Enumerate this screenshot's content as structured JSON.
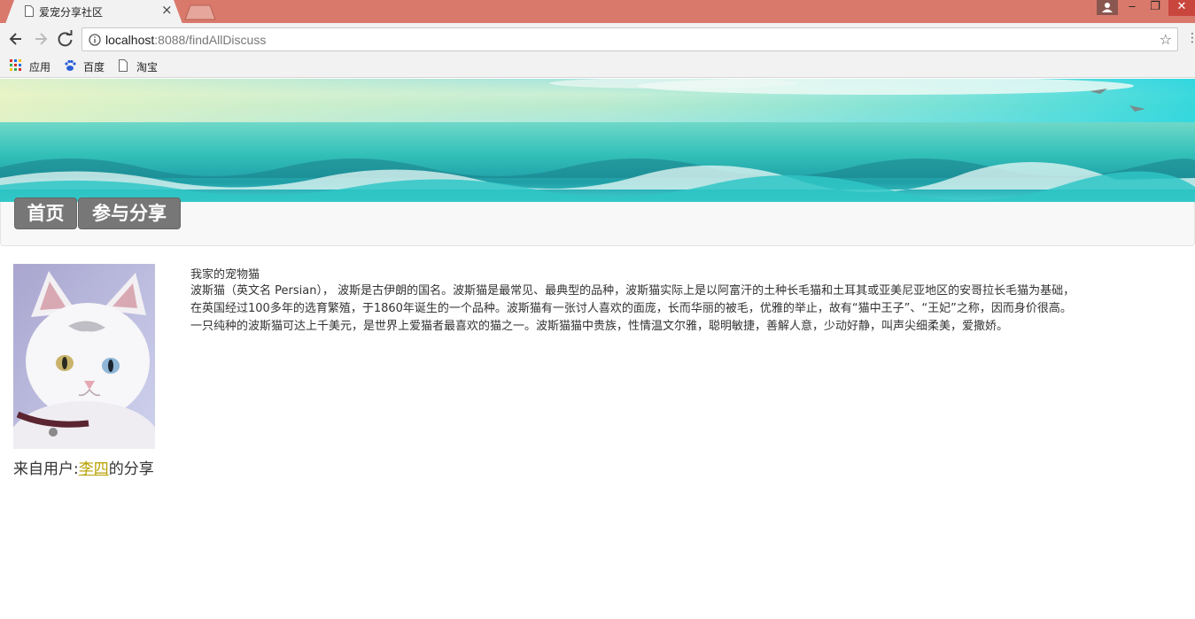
{
  "browser": {
    "tab_title": "爱宠分享社区",
    "tab_close": "×",
    "url_host": "localhost",
    "url_rest": ":8088/findAllDiscuss",
    "star": "☆",
    "more": "⋮",
    "window_controls": {
      "minimize": "‒",
      "restore": "❐",
      "close": "✕"
    }
  },
  "bookmarks": [
    {
      "label": "应用",
      "icon": "apps-grid-icon"
    },
    {
      "label": "百度",
      "icon": "baidu-paw-icon"
    },
    {
      "label": "淘宝",
      "icon": "page-icon"
    }
  ],
  "nav": {
    "home": "首页",
    "share": "参与分享"
  },
  "post": {
    "title": "我家的宠物猫",
    "body": "波斯猫（英文名 Persian）， 波斯是古伊朗的国名。波斯猫是最常见、最典型的品种，波斯猫实际上是以阿富汗的土种长毛猫和土耳其或亚美尼亚地区的安哥拉长毛猫为基础，在英国经过100多年的选育繁殖，于1860年诞生的一个品种。波斯猫有一张讨人喜欢的面庞，长而华丽的被毛，优雅的举止，故有“猫中王子”、“王妃”之称，因而身价很高。一只纯种的波斯猫可达上千美元，是世界上爱猫者最喜欢的猫之一。波斯猫猫中贵族，性情温文尔雅，聪明敏捷，善解人意，少动好静，叫声尖细柔美，爱撒娇。",
    "from_prefix": "来自用户:",
    "author": "李四",
    "from_suffix": "的分享"
  },
  "colors": {
    "titlebar": "#d9796b",
    "nav_button": "#777777",
    "author_link": "#b8a000"
  }
}
